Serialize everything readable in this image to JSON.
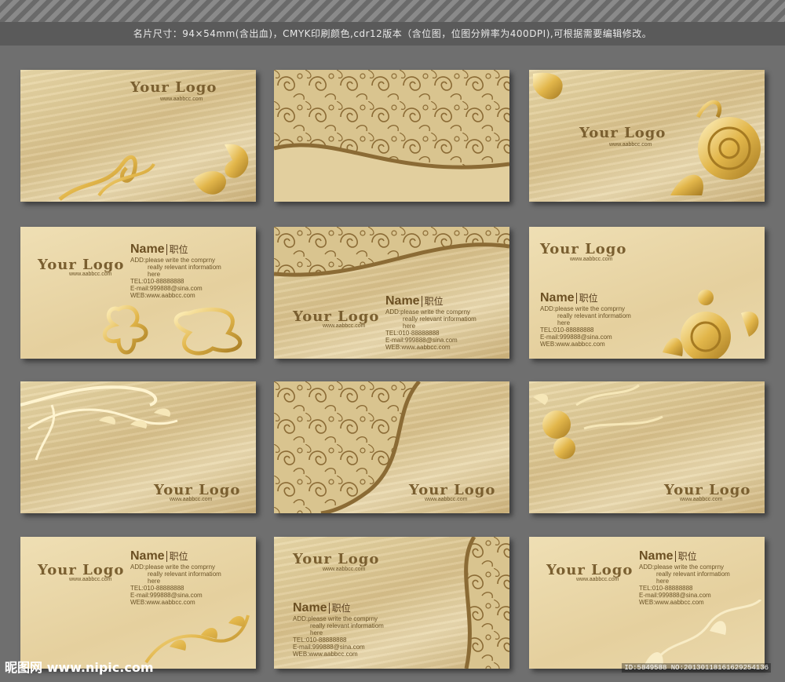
{
  "header": {
    "text": "名片尺寸：94×54mm(含出血)，CMYK印刷颜色,cdr12版本（含位图，位图分辨率为400DPI),可根据需要编辑修改。"
  },
  "logo_text": "Your Logo",
  "url_text": "www.aabbcc.com",
  "contact": {
    "name": "Name",
    "job": "职位",
    "add1": "ADD:please write the comprny",
    "add2": "really relevant informatiom",
    "add3": "here",
    "tel": "TEL:010-88888888",
    "mail": "E-mail:999888@sina.com",
    "web": "WEB:www.aabbcc.com"
  },
  "footer": {
    "left": "昵图网 www.nipic.com",
    "right": "ID:5849588 NO:20130118161629254136"
  },
  "colors": {
    "gold": "#d8c08a",
    "brown": "#7a5f30",
    "bg": "#6f6f6f"
  },
  "icons": [
    "floral-ornament-icon",
    "rose-ornament-icon",
    "swirl-pattern-icon"
  ]
}
